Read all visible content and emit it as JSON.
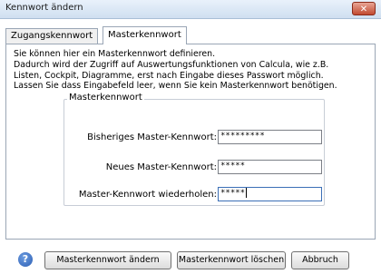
{
  "window": {
    "title": "Kennwort ändern",
    "close_label": "✕"
  },
  "tabs": [
    {
      "label": "Zugangskennwort",
      "active": false
    },
    {
      "label": "Masterkennwort",
      "active": true
    }
  ],
  "info_lines": [
    "Sie können hier ein Masterkennwort definieren.",
    "Dadurch wird der Zugriff auf Auswertungsfunktionen von Calcula, wie z.B.",
    "Listen, Cockpit, Diagramme, erst nach Eingabe dieses Passwort möglich.",
    "Lassen Sie dass Eingabefeld leer, wenn Sie kein Masterkennwort benötigen."
  ],
  "group": {
    "legend": "Masterkennwort",
    "fields": [
      {
        "label": "Bisheriges Master-Kennwort:",
        "value": "*********"
      },
      {
        "label": "Neues Master-Kennwort:",
        "value": "*****"
      },
      {
        "label": "Master-Kennwort wiederholen:",
        "value": "*****"
      }
    ]
  },
  "buttons": {
    "change": "Masterkennwort ändern",
    "delete": "Masterkennwort löschen",
    "cancel": "Abbruch"
  },
  "icons": {
    "help": "help-icon",
    "close": "close-icon"
  },
  "colors": {
    "help_blue": "#2d5fb5",
    "close_red": "#c24a31"
  }
}
